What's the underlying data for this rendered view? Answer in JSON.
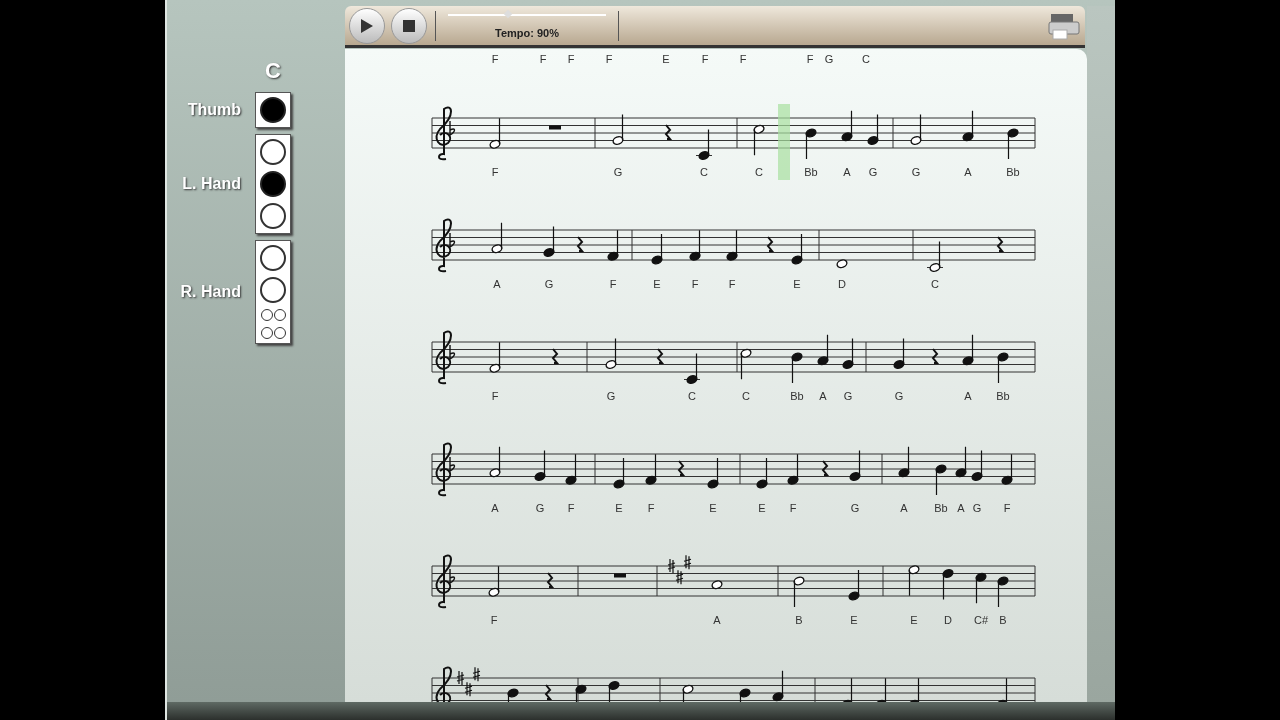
{
  "fingering": {
    "note": "C",
    "groups": [
      {
        "label": "Thumb",
        "holes": [
          {
            "kind": "single",
            "closed": true
          }
        ]
      },
      {
        "label": "L. Hand",
        "holes": [
          {
            "kind": "single",
            "closed": false
          },
          {
            "kind": "single",
            "closed": true
          },
          {
            "kind": "single",
            "closed": false
          }
        ]
      },
      {
        "label": "R. Hand",
        "holes": [
          {
            "kind": "single",
            "closed": false
          },
          {
            "kind": "single",
            "closed": false
          },
          {
            "kind": "double",
            "closed": false
          },
          {
            "kind": "double",
            "closed": false
          }
        ]
      }
    ]
  },
  "toolbar": {
    "tempo": {
      "label": "Tempo: 90%",
      "level": 0.38
    }
  },
  "score": {
    "systems": [
      {
        "kind": "one-flat",
        "above": [
          "F",
          "F",
          "F",
          "F",
          "E",
          "F",
          "F",
          "F",
          "G",
          "C"
        ],
        "below": [
          "F",
          "G",
          "C",
          "C",
          "Bb",
          "A",
          "G",
          "G",
          "A",
          "Bb"
        ]
      },
      {
        "kind": "one-flat",
        "below": [
          "A",
          "G",
          "F",
          "E",
          "F",
          "F",
          "E",
          "D",
          "C"
        ]
      },
      {
        "kind": "one-flat",
        "below": [
          "F",
          "G",
          "C",
          "C",
          "Bb",
          "A",
          "G",
          "G",
          "A",
          "Bb"
        ]
      },
      {
        "kind": "one-flat",
        "below": [
          "A",
          "G",
          "F",
          "E",
          "F",
          "E",
          "E",
          "F",
          "G",
          "A",
          "Bb",
          "A",
          "G",
          "F"
        ]
      },
      {
        "kind": "one-flat",
        "below": [
          "F",
          "A",
          "B",
          "E",
          "E",
          "D",
          "C#",
          "B"
        ]
      },
      {
        "kind": "three-sharps"
      }
    ]
  }
}
